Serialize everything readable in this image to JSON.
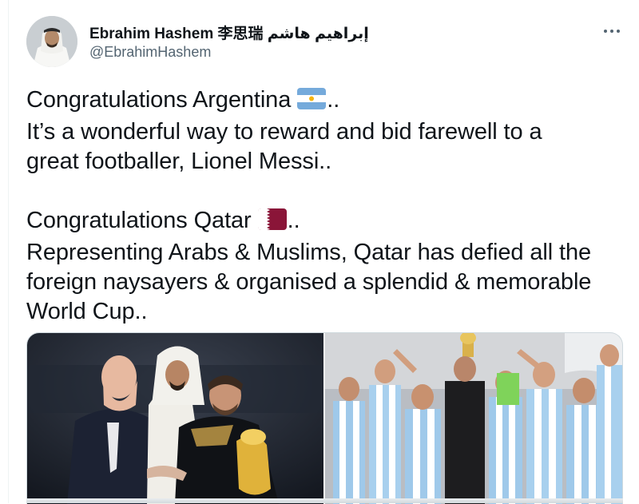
{
  "tweet": {
    "author": {
      "display_name": "Ebrahim Hashem 李思瑞 إبراهيم هاشم",
      "handle": "@EbrahimHashem",
      "avatar_icon": "profile-photo"
    },
    "more_icon": "more-options-icon",
    "text": {
      "line1": "Congratulations Argentina",
      "line1_suffix": "..",
      "line2": "It’s a wonderful way to reward and bid farewell to a",
      "line3": "great footballer, Lionel Messi..",
      "line4": "Congratulations Qatar",
      "line4_suffix": "..",
      "line5": "Representing Arabs & Muslims, Qatar has defied all the",
      "line6": "foreign naysayers & organised a splendid & memorable",
      "line7": "World Cup.."
    },
    "emoji": {
      "argentina": "argentina-flag-emoji",
      "qatar": "qatar-flag-emoji"
    },
    "media": [
      {
        "icon": "photo-trophy-presentation"
      },
      {
        "icon": "photo-team-celebration"
      }
    ],
    "colors": {
      "text": "#0f1419",
      "secondary": "#536471",
      "border": "#cfd9de"
    }
  }
}
